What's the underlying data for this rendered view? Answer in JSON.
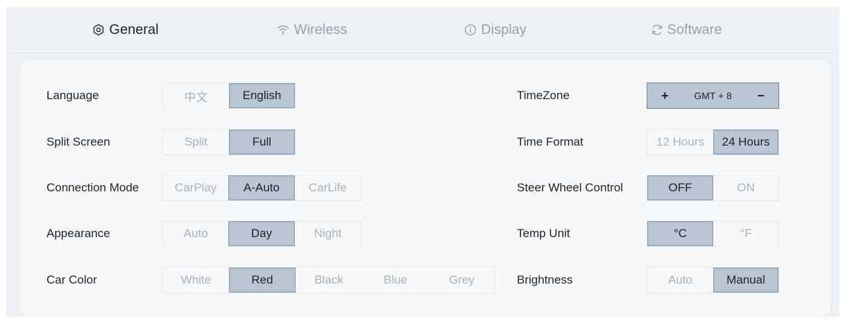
{
  "tabs": [
    {
      "label": "General",
      "icon": "settings-icon",
      "active": true
    },
    {
      "label": "Wireless",
      "icon": "wifi-icon",
      "active": false
    },
    {
      "label": "Display",
      "icon": "info-icon",
      "active": false
    },
    {
      "label": "Software",
      "icon": "refresh-icon",
      "active": false
    }
  ],
  "left": {
    "language": {
      "label": "Language",
      "options": [
        "中文",
        "English"
      ],
      "selected": "English"
    },
    "split_screen": {
      "label": "Split Screen",
      "options": [
        "Split",
        "Full"
      ],
      "selected": "Full"
    },
    "connection_mode": {
      "label": "Connection Mode",
      "options": [
        "CarPlay",
        "A-Auto",
        "CarLife"
      ],
      "selected": "A-Auto"
    },
    "appearance": {
      "label": "Appearance",
      "options": [
        "Auto",
        "Day",
        "Night"
      ],
      "selected": "Day"
    },
    "car_color": {
      "label": "Car Color",
      "options": [
        "White",
        "Red",
        "Black",
        "Blue",
        "Grey"
      ],
      "selected": "Red"
    }
  },
  "right": {
    "timezone": {
      "label": "TimeZone",
      "plus": "+",
      "value": "GMT + 8",
      "minus": "−"
    },
    "time_format": {
      "label": "Time Format",
      "options": [
        "12 Hours",
        "24 Hours"
      ],
      "selected": "24 Hours"
    },
    "steer_wheel_control": {
      "label": "Steer Wheel Control",
      "options": [
        "OFF",
        "ON"
      ],
      "selected": "OFF"
    },
    "temp_unit": {
      "label": "Temp Unit",
      "options": [
        "°C",
        "°F"
      ],
      "selected": "°C"
    },
    "brightness": {
      "label": "Brightness",
      "options": [
        "Auto",
        "Manual"
      ],
      "selected": "Manual"
    }
  },
  "colors": {
    "selected_bg": "#b8c7d3",
    "selected_border": "#8a9bab",
    "unselected_text": "#aab1b7",
    "panel_bg": "#f6f8fa",
    "frame_bg": "#edf1f5"
  }
}
